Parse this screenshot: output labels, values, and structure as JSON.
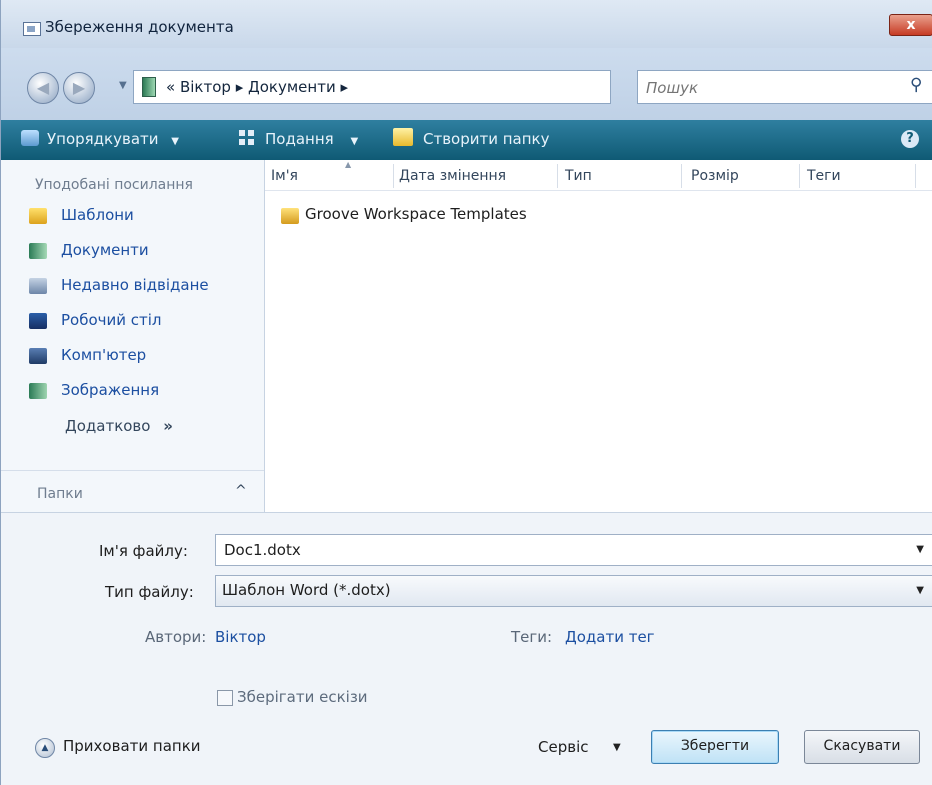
{
  "window": {
    "title": "Збереження документа",
    "close_label": "x"
  },
  "address": {
    "path_prefix": "«",
    "crumbs": [
      "Віктор",
      "Документи"
    ],
    "separator": "▸"
  },
  "search": {
    "placeholder": "Пошук"
  },
  "toolbar": {
    "organize_label": "Упорядкувати",
    "views_label": "Подання",
    "new_folder_label": "Створити папку",
    "dropdown_glyph": "▼",
    "help_glyph": "?"
  },
  "navpane": {
    "header": "Уподобані посилання",
    "items": [
      {
        "label": "Шаблони",
        "icon": "templates-folder-icon"
      },
      {
        "label": "Документи",
        "icon": "documents-icon"
      },
      {
        "label": "Недавно відвідане",
        "icon": "recent-places-icon"
      },
      {
        "label": "Робочий стіл",
        "icon": "desktop-icon"
      },
      {
        "label": "Комп'ютер",
        "icon": "computer-icon"
      },
      {
        "label": "Зображення",
        "icon": "pictures-icon"
      }
    ],
    "more_label": "Додатково",
    "more_glyph": "»",
    "folders_label": "Папки",
    "folders_glyph": "^"
  },
  "filelist": {
    "columns": [
      "Ім'я",
      "Дата змінення",
      "Тип",
      "Розмір",
      "Теги"
    ],
    "rows": [
      {
        "name": "Groove Workspace Templates",
        "icon": "folder-icon"
      }
    ]
  },
  "form": {
    "filename_label": "Ім'я файлу:",
    "filename_value": "Doc1.dotx",
    "filetype_label": "Тип файлу:",
    "filetype_value": "Шаблон Word (*.dotx)",
    "authors_label": "Автори:",
    "authors_value": "Віктор",
    "tags_label": "Теги:",
    "tags_value": "Додати тег",
    "thumbnail_label": "Зберігати ескізи",
    "thumbnail_checked": false
  },
  "footer": {
    "hide_folders_label": "Приховати папки",
    "tools_label": "Сервіс",
    "save_label": "Зберегти",
    "cancel_label": "Скасувати"
  },
  "colors": {
    "toolbar_bg": "#0f5a74",
    "link_blue": "#1c4fa1",
    "close_red": "#c63b24"
  }
}
